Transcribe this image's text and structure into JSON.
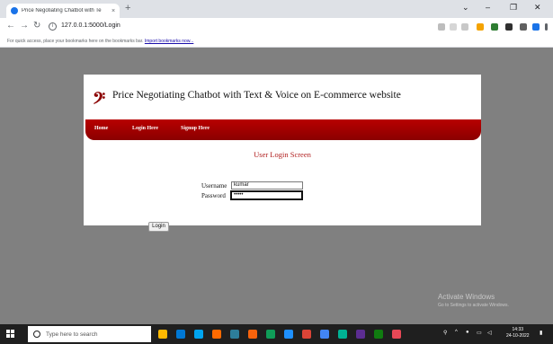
{
  "browser": {
    "tab_title": "Price Negotiating Chatbot with Te",
    "tab_close": "×",
    "new_tab": "+",
    "url": "127.0.0.1:5000/Login",
    "bookmarks_text": "For quick access, place your bookmarks here on the bookmarks bar.",
    "bookmarks_link": "Import bookmarks now...",
    "window_controls": [
      "⌄",
      "–",
      "❐",
      "✕"
    ]
  },
  "site": {
    "logo_mark": "𝄢",
    "title": "Price Negotiating Chatbot with Text & Voice on E-commerce website",
    "nav": [
      "Home",
      "Login Here",
      "Signup Here"
    ]
  },
  "login": {
    "screen_title": "User Login Screen",
    "username_label": "Username",
    "username_value": "kumar",
    "password_label": "Password",
    "password_value": "•••••",
    "button_label": "Login"
  },
  "watermark": {
    "line1": "Activate Windows",
    "line2": "Go to Settings to activate Windows."
  },
  "taskbar": {
    "search_placeholder": "Type here to search",
    "time": "14:33",
    "date": "24-10-2022",
    "colors": [
      "#ffb900",
      "#0078d4",
      "#00a4ef",
      "#ff6a00",
      "#2d7d9a",
      "#f7630c",
      "#0f9d58",
      "#1e90ff",
      "#db4437",
      "#4285f4",
      "#00b294",
      "#5c2d91",
      "#107c10",
      "#e74856"
    ]
  }
}
